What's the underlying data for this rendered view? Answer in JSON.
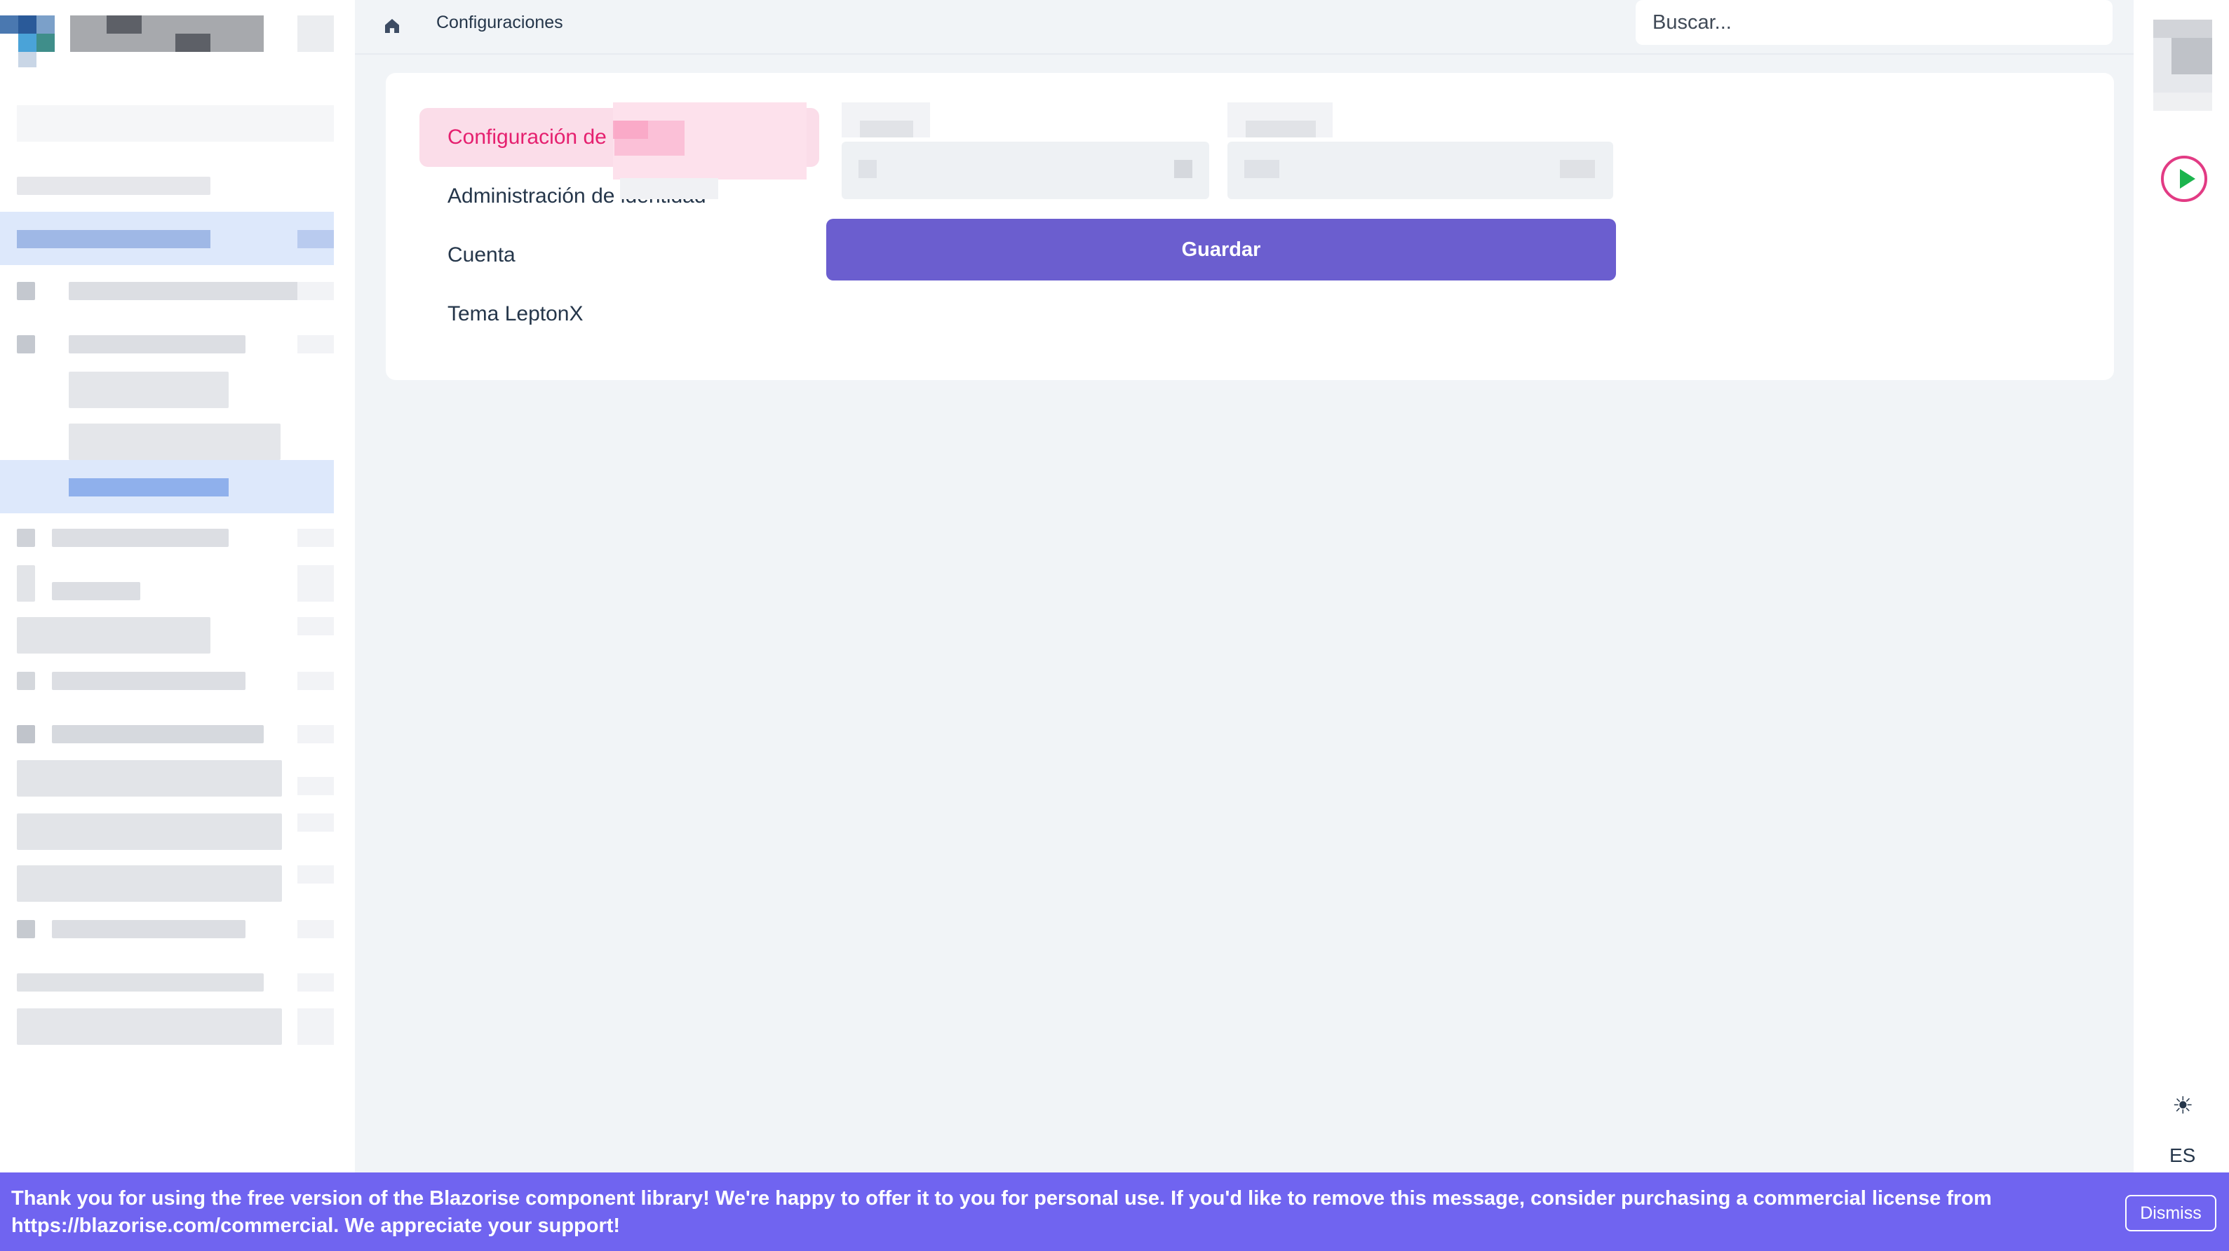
{
  "breadcrumb": {
    "current": "Configuraciones"
  },
  "search": {
    "placeholder": "Buscar..."
  },
  "settings_nav": [
    {
      "label": "Configuración de",
      "active": true
    },
    {
      "label": "Administración de identidad",
      "active": false
    },
    {
      "label": "Cuenta",
      "active": false
    },
    {
      "label": "Tema LeptonX",
      "active": false
    }
  ],
  "form": {
    "save_label": "Guardar"
  },
  "rail": {
    "language": "ES",
    "theme_icon": "☀"
  },
  "banner": {
    "message": "Thank you for using the free version of the Blazorise component library! We're happy to offer it to you for personal use. If you'd like to remove this message, consider purchasing a commercial license from https://blazorise.com/commercial. We appreciate your support!",
    "dismiss_label": "Dismiss"
  },
  "colors": {
    "accent": "#6b5ecf",
    "active_nav_bg": "#fbdde9",
    "active_nav_text": "#e5206f",
    "banner_bg": "#7064f0",
    "play_ring": "#e23b84",
    "play_triangle": "#1bb44d"
  }
}
